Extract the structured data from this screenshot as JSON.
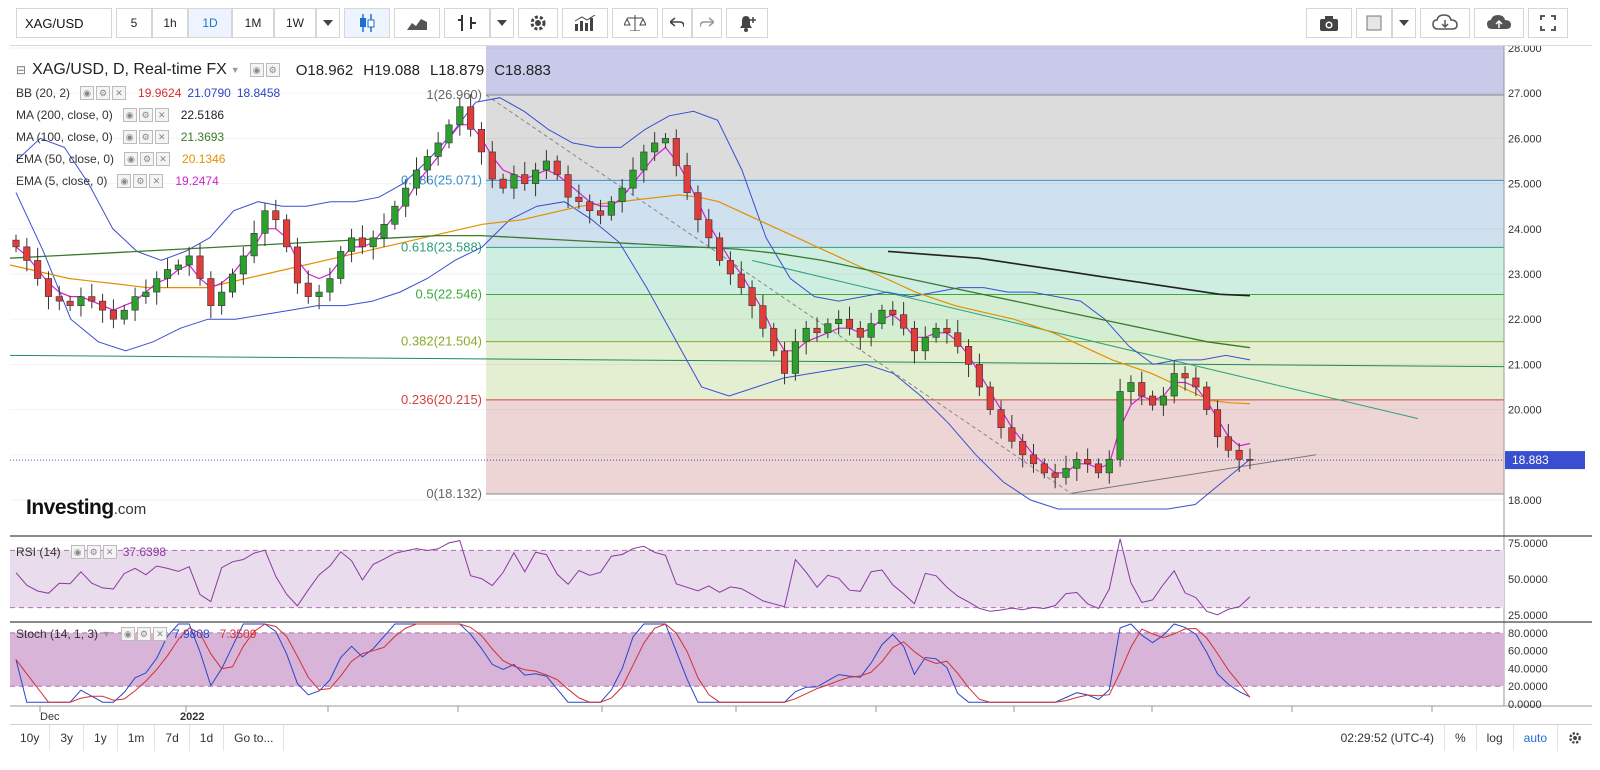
{
  "toolbar": {
    "symbol": "XAG/USD",
    "intervals": [
      "5",
      "1h",
      "1D",
      "1M",
      "1W"
    ],
    "active_interval": "1D"
  },
  "legend": {
    "title": "XAG/USD, D, Real-time FX",
    "open": "O18.962",
    "high": "H19.088",
    "low": "L18.879",
    "close": "C18.883",
    "indicators": [
      {
        "label": "BB (20, 2)",
        "values": [
          "19.9624",
          "21.0790",
          "18.8458"
        ],
        "colors": [
          "#d43030",
          "#2a45c8",
          "#2a45c8"
        ]
      },
      {
        "label": "MA (200, close, 0)",
        "values": [
          "22.5186"
        ],
        "colors": [
          "#222222"
        ]
      },
      {
        "label": "MA (100, close, 0)",
        "values": [
          "21.3693"
        ],
        "colors": [
          "#3a7a2a"
        ]
      },
      {
        "label": "EMA (50, close, 0)",
        "values": [
          "20.1346"
        ],
        "colors": [
          "#e39000"
        ]
      },
      {
        "label": "EMA (5, close, 0)",
        "values": [
          "19.2474"
        ],
        "colors": [
          "#d020d0"
        ]
      }
    ]
  },
  "fib": {
    "levels": [
      {
        "label": "1(26.960)",
        "price": 26.96,
        "fill": "#dcdcdc",
        "line": "#888888",
        "text": "#666666"
      },
      {
        "label": "0.786(25.071)",
        "price": 25.071,
        "fill": "#cfe0ee",
        "line": "#3a8fd0",
        "text": "#3a8fd0"
      },
      {
        "label": "0.618(23.588)",
        "price": 23.588,
        "fill": "#cdeee0",
        "line": "#2aa07a",
        "text": "#2aa07a"
      },
      {
        "label": "0.5(22.546)",
        "price": 22.546,
        "fill": "#d3eed3",
        "line": "#3aaa3a",
        "text": "#3aaa3a"
      },
      {
        "label": "0.382(21.504)",
        "price": 21.504,
        "fill": "#e4eed0",
        "line": "#8aaa2a",
        "text": "#8aaa2a"
      },
      {
        "label": "0.236(20.215)",
        "price": 20.215,
        "fill": "#eed5d5",
        "line": "#d44040",
        "text": "#d44040"
      },
      {
        "label": "0(18.132)",
        "price": 18.132,
        "fill": "#ecd2d2",
        "line": "#888888",
        "text": "#666666"
      }
    ],
    "above_fill": "#c9c9ea"
  },
  "price_axis": {
    "ticks": [
      "28.000",
      "27.000",
      "26.000",
      "25.000",
      "24.000",
      "23.000",
      "22.000",
      "21.000",
      "20.000",
      "18.000"
    ],
    "current": "18.883"
  },
  "rsi": {
    "label": "RSI (14)",
    "value": "37.6398",
    "ticks": [
      "75.0000",
      "50.0000",
      "25.0000"
    ]
  },
  "stoch": {
    "label": "Stoch (14, 1, 3)",
    "k": "7.9808",
    "d": "7.3509",
    "ticks": [
      "80.0000",
      "60.0000",
      "40.0000",
      "20.0000",
      "0.0000"
    ]
  },
  "time_axis": [
    "Dec",
    "2022"
  ],
  "logo": {
    "brand": "Investing",
    "suffix": ".com"
  },
  "bottom": {
    "ranges": [
      "10y",
      "3y",
      "1y",
      "1m",
      "7d",
      "1d",
      "Go to..."
    ],
    "clock": "02:29:52 (UTC-4)",
    "opts": [
      "%",
      "log",
      "auto"
    ]
  },
  "chart_data": {
    "type": "candlestick",
    "symbol": "XAG/USD",
    "ylim": [
      17.6,
      28.0
    ],
    "current_price": 18.883,
    "ohlc_last": {
      "open": 18.962,
      "high": 19.088,
      "low": 18.879,
      "close": 18.883
    },
    "closes": [
      23.6,
      23.3,
      22.9,
      22.5,
      22.4,
      22.3,
      22.5,
      22.4,
      22.2,
      22.0,
      22.2,
      22.5,
      22.6,
      22.9,
      23.1,
      23.2,
      23.4,
      22.9,
      22.3,
      22.6,
      23.0,
      23.4,
      23.9,
      24.4,
      24.2,
      23.6,
      22.8,
      22.5,
      22.6,
      22.9,
      23.5,
      23.8,
      23.6,
      23.8,
      24.1,
      24.5,
      24.9,
      25.3,
      25.6,
      25.9,
      26.3,
      26.7,
      26.2,
      25.7,
      25.1,
      24.9,
      25.2,
      25.0,
      25.3,
      25.5,
      25.2,
      24.7,
      24.6,
      24.4,
      24.3,
      24.6,
      24.9,
      25.3,
      25.7,
      25.9,
      26.0,
      25.4,
      24.8,
      24.2,
      23.8,
      23.3,
      23.0,
      22.7,
      22.3,
      21.8,
      21.3,
      20.8,
      21.5,
      21.8,
      21.7,
      21.9,
      22.0,
      21.8,
      21.6,
      21.9,
      22.2,
      22.1,
      21.8,
      21.3,
      21.6,
      21.8,
      21.7,
      21.4,
      21.0,
      20.5,
      20.0,
      19.6,
      19.3,
      19.0,
      18.8,
      18.6,
      18.5,
      18.7,
      18.9,
      18.8,
      18.6,
      18.9,
      20.4,
      20.6,
      20.3,
      20.1,
      20.3,
      20.8,
      20.7,
      20.5,
      20.0,
      19.4,
      19.1,
      18.9,
      18.883
    ],
    "ema5": [
      23.6,
      23.4,
      23.1,
      22.8,
      22.6,
      22.5,
      22.5,
      22.4,
      22.3,
      22.2,
      22.3,
      22.4,
      22.6,
      22.8,
      22.9,
      23.1,
      23.2,
      22.9,
      22.7,
      22.8,
      23.0,
      23.3,
      23.6,
      24.0,
      24.0,
      23.8,
      23.3,
      23.0,
      22.9,
      23.0,
      23.3,
      23.6,
      23.6,
      23.7,
      24.0,
      24.3,
      24.6,
      25.0,
      25.3,
      25.6,
      26.0,
      26.3,
      26.3,
      26.0,
      25.6,
      25.3,
      25.2,
      25.1,
      25.2,
      25.3,
      25.2,
      25.0,
      24.8,
      24.6,
      24.5,
      24.5,
      24.7,
      25.0,
      25.3,
      25.6,
      25.8,
      25.5,
      25.1,
      24.6,
      24.1,
      23.7,
      23.3,
      23.0,
      22.6,
      22.2,
      21.7,
      21.3,
      21.3,
      21.5,
      21.6,
      21.7,
      21.8,
      21.8,
      21.7,
      21.8,
      22.0,
      22.1,
      21.9,
      21.6,
      21.6,
      21.7,
      21.7,
      21.5,
      21.2,
      20.8,
      20.4,
      20.0,
      19.6,
      19.3,
      19.0,
      18.8,
      18.6,
      18.6,
      18.8,
      18.8,
      18.7,
      18.8,
      19.6,
      20.1,
      20.3,
      20.2,
      20.3,
      20.6,
      20.6,
      20.5,
      20.2,
      19.8,
      19.4,
      19.2,
      19.25
    ],
    "ema50": [
      23.2,
      23.1,
      23.0,
      22.9,
      22.85,
      22.8,
      22.75,
      22.7,
      22.7,
      22.7,
      22.7,
      22.8,
      22.9,
      23.0,
      23.1,
      23.2,
      23.3,
      23.4,
      23.5,
      23.6,
      23.7,
      23.8,
      23.9,
      24.0,
      24.1,
      24.15,
      24.2,
      24.3,
      24.4,
      24.5,
      24.55,
      24.6,
      24.65,
      24.7,
      24.75,
      24.7,
      24.6,
      24.4,
      24.2,
      24.0,
      23.8,
      23.6,
      23.4,
      23.2,
      23.0,
      22.8,
      22.6,
      22.45,
      22.3,
      22.2,
      22.1,
      22.0,
      21.85,
      21.7,
      21.5,
      21.3,
      21.1,
      20.95,
      20.8,
      20.6,
      20.4,
      20.2,
      20.15,
      20.13
    ],
    "ma100": [
      23.35,
      23.4,
      23.45,
      23.5,
      23.55,
      23.6,
      23.65,
      23.7,
      23.75,
      23.8,
      23.85,
      23.85,
      23.8,
      23.75,
      23.7,
      23.65,
      23.6,
      23.55,
      23.45,
      23.3,
      23.1,
      22.9,
      22.7,
      22.5,
      22.3,
      22.1,
      21.9,
      21.7,
      21.5,
      21.37
    ],
    "ma200": [
      23.5,
      23.45,
      23.4,
      23.35,
      23.25,
      23.15,
      23.05,
      22.95,
      22.85,
      22.75,
      22.65,
      22.55,
      22.52
    ],
    "bb_upper": [
      25.5,
      26.0,
      25.8,
      25.0,
      24.0,
      23.5,
      23.3,
      23.5,
      23.8,
      24.4,
      24.6,
      24.5,
      24.5,
      24.6,
      24.6,
      24.7,
      25.0,
      25.5,
      26.1,
      26.8,
      26.9,
      26.6,
      26.2,
      25.9,
      25.8,
      25.8,
      26.2,
      26.5,
      26.6,
      26.4,
      25.3,
      23.8,
      22.9,
      22.5,
      22.4,
      22.5,
      22.6,
      22.5,
      22.6,
      22.7,
      22.7,
      22.6,
      22.6,
      22.5,
      22.4,
      22.0,
      21.4,
      21.0,
      21.1,
      21.1,
      21.2,
      21.1
    ],
    "bb_lower": [
      24.8,
      23.5,
      22.0,
      21.5,
      21.3,
      21.5,
      21.8,
      22.0,
      22.0,
      22.1,
      22.2,
      22.3,
      22.3,
      22.4,
      22.6,
      22.9,
      23.3,
      23.6,
      24.2,
      24.5,
      24.6,
      24.2,
      23.7,
      22.7,
      21.6,
      20.5,
      20.3,
      20.5,
      20.7,
      20.8,
      20.9,
      21.0,
      20.8,
      20.3,
      19.7,
      19.0,
      18.4,
      18.0,
      17.8,
      17.8,
      17.8,
      17.8,
      17.8,
      17.9,
      18.4,
      18.9
    ],
    "rsi": {
      "ylim": [
        20,
        80
      ],
      "bands": [
        70,
        30
      ],
      "last": 37.6398
    },
    "stoch": {
      "ylim": [
        0,
        90
      ],
      "bands": [
        80,
        20
      ],
      "k_last": 7.9808,
      "d_last": 7.3509
    }
  }
}
